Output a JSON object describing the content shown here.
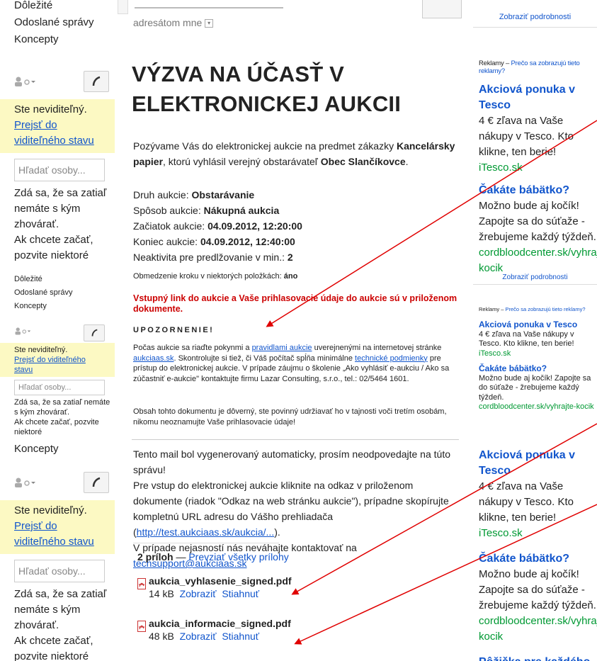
{
  "sidebar": {
    "top": {
      "items": [
        "Dôležité",
        "Odoslané správy",
        "Koncepty"
      ],
      "status": "Ste neviditeľný.",
      "go_visible": "Prejsť do viditeľného stavu",
      "search_placeholder": "Hľadať osoby...",
      "empty_1": "Zdá sa, že sa zatiaľ nemáte s kým zhovárať.",
      "empty_2": "Ak chcete začať, pozvite niektoré"
    },
    "mid": {
      "items": [
        "Dôležité",
        "Odoslané správy",
        "Koncepty"
      ],
      "status": "Ste neviditeľný.",
      "go_visible": "Prejsť do viditeľného stavu",
      "search_placeholder": "Hľadať osoby...",
      "empty_1": "Zdá sa, že sa zatiaľ nemáte s kým zhovárať.",
      "empty_2": "Ak chcete začať, pozvite niektoré"
    },
    "bottom": {
      "items": [
        "Koncepty"
      ],
      "status": "Ste neviditeľný.",
      "go_visible": "Prejsť do viditeľného stavu",
      "search_placeholder": "Hľadať osoby...",
      "empty_1": "Zdá sa, že sa zatiaľ nemáte s kým zhovárať.",
      "empty_2": "Ak chcete začať, pozvite niektoré"
    }
  },
  "email": {
    "recipients_text": "adresátom mne",
    "title": "VÝZVA NA ÚČASŤ V ELEKTRONICKEJ AUKCII",
    "intro_1": "Pozývame Vás do elektronickej aukcie na predmet zákazky ",
    "intro_bold_1": "Kancelársky papier",
    "intro_2": ", ktorú vyhlásil verejný obstarávateľ ",
    "intro_bold_2": "Obec Slančíkovce",
    "intro_3": ".",
    "details": [
      {
        "label": "Druh aukcie: ",
        "value": "Obstarávanie"
      },
      {
        "label": "Spôsob aukcie: ",
        "value": "Nákupná aukcia"
      },
      {
        "label": "Začiatok aukcie: ",
        "value": "04.09.2012, 12:20:00"
      },
      {
        "label": "Koniec aukcie: ",
        "value": "04.09.2012, 12:40:00"
      },
      {
        "label": "Neaktivita pre predlžovanie v min.: ",
        "value": "2"
      }
    ],
    "step_label": "Obmedzenie kroku v niektorých položkách: ",
    "step_value": "áno",
    "red_notice": "Vstupný link do aukcie a Vaše prihlasovacie údaje do aukcie sú v priloženom dokumente.",
    "warning_head": "UPOZORNENIE!",
    "p1_a": "Počas aukcie sa riaďte pokynmi a ",
    "p1_link1": "pravidlami aukcie",
    "p1_b": " uverejnenými na internetovej stránke ",
    "p1_link2": "aukciaas.sk",
    "p1_c": ". Skontrolujte si tiež, či Váš počítač spĺňa minimálne ",
    "p1_link3": "technické podmienky",
    "p1_d": " pre prístup do elektronickej aukcie. V prípade záujmu o školenie „Ako vyhlásiť e-aukciu / Ako sa zúčastniť e-aukcie\" kontaktujte firmu Lazar Consulting, s.r.o., tel.: 02/5464 1601.",
    "p2": "Obsah tohto dokumentu je dôverný, ste povinný udržiavať ho v tajnosti voči tretím osobám, nikomu neoznamujte Vaše prihlasovacie údaje!",
    "auto_1": "Tento mail bol vygenerovaný automaticky, prosím neodpovedajte na túto správu!",
    "auto_2": "Pre vstup do elektronickej aukcie kliknite na odkaz v priloženom dokumente (riadok \"Odkaz na web stránku aukcie\"), prípadne skopírujte kompletnú URL adresu do Vášho prehliadača (",
    "auto_link": "http://test.aukciaas.sk/aukcia/...",
    "auto_3": ").",
    "auto_4": "V prípade nejasností nás neváhajte kontaktovať na ",
    "auto_mail": "techsupport@aukciaas.sk",
    "attach_count": "2 príloh",
    "attach_dash": " — ",
    "attach_all": "Prevziať všetky prílohy",
    "attachments": [
      {
        "name": "aukcia_vyhlasenie_signed.pdf",
        "size": "14 kB",
        "view": "Zobraziť",
        "download": "Stiahnuť"
      },
      {
        "name": "aukcia_informacie_signed.pdf",
        "size": "48 kB",
        "view": "Zobraziť",
        "download": "Stiahnuť"
      }
    ]
  },
  "ads": {
    "details_link": "Zobraziť podrobnosti",
    "header_a": "Reklamy – ",
    "header_b": "Prečo sa zobrazujú tieto reklamy?",
    "ad1_title": "Akciová ponuka v Tesco",
    "ad1_text": "4 € zľava na Vaše nákupy v Tesco. Kto klikne, ten berie!",
    "ad1_url": "iTesco.sk",
    "ad2_title": "Čakáte bábätko?",
    "ad2_text": "Možno bude aj kočík! Zapojte sa do súťaže - žrebujeme každý týždeň.",
    "ad2_url": "cordbloodcenter.sk/vyhrajte-kocik",
    "ad3_title": "Pôžička pre každého"
  },
  "colors": {
    "link": "#1155cc",
    "ad_url": "#009933",
    "red": "#cc0000",
    "invisible_bg": "#fcf9c3"
  }
}
